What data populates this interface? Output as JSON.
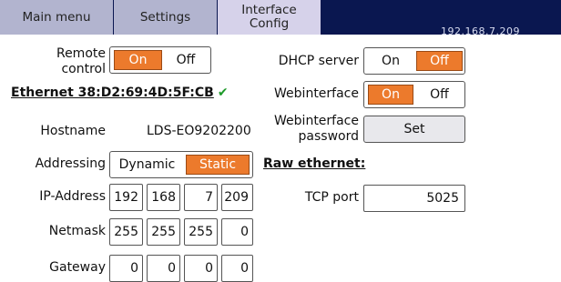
{
  "tabs": [
    {
      "label": "Main menu"
    },
    {
      "label": "Settings"
    },
    {
      "label": "Interface\nConfig"
    }
  ],
  "ip_address_display": "192.168.7.209",
  "remote_control": {
    "label": "Remote\ncontrol",
    "on_label": "On",
    "off_label": "Off",
    "selected": "On"
  },
  "ethernet_heading": "Ethernet 38:D2:69:4D:5F:CB",
  "ethernet_check": "✔",
  "hostname": {
    "label": "Hostname",
    "value": "LDS-EO9202200"
  },
  "addressing": {
    "label": "Addressing",
    "dynamic_label": "Dynamic",
    "static_label": "Static",
    "selected": "Static"
  },
  "ip_address": {
    "label": "IP-Address",
    "octets": [
      "192",
      "168",
      "7",
      "209"
    ]
  },
  "netmask": {
    "label": "Netmask",
    "octets": [
      "255",
      "255",
      "255",
      "0"
    ]
  },
  "gateway": {
    "label": "Gateway",
    "octets": [
      "0",
      "0",
      "0",
      "0"
    ]
  },
  "dhcp_server": {
    "label": "DHCP server",
    "on_label": "On",
    "off_label": "Off",
    "selected": "Off"
  },
  "webinterface": {
    "label": "Webinterface",
    "on_label": "On",
    "off_label": "Off",
    "selected": "On"
  },
  "webinterface_password": {
    "label": "Webinterface\npassword",
    "button_label": "Set"
  },
  "raw_ethernet_heading": "Raw ethernet:",
  "tcp_port": {
    "label": "TCP port",
    "value": "5025"
  },
  "colors": {
    "accent": "#ec7a2c",
    "topbar": "#0a1750",
    "tab": "#b2b4cf",
    "tab_active": "#d6d2ea",
    "check": "#1e9a2a"
  }
}
